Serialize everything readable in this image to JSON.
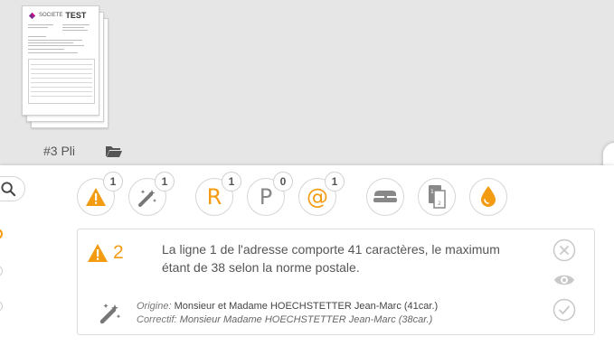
{
  "document": {
    "label": "#3 Pli",
    "logo_company": "SOCIETE",
    "logo_test": "TEST"
  },
  "toolbar": {
    "tools": [
      {
        "name": "warning",
        "badge": "1"
      },
      {
        "name": "magic-wand",
        "badge": "1"
      },
      {
        "name": "recommande",
        "letter": "R",
        "badge": "1"
      },
      {
        "name": "prioritaire",
        "letter": "P",
        "badge": "0"
      },
      {
        "name": "email",
        "letter": "@",
        "badge": "1"
      },
      {
        "name": "stapler"
      },
      {
        "name": "pages"
      },
      {
        "name": "ink-drop"
      }
    ]
  },
  "alert": {
    "count": "2",
    "message": "La ligne 1 de l'adresse comporte 41 caractères, le maximum étant de 38 selon la norme postale.",
    "origin_label": "Origine:",
    "origin_value": "Monsieur et Madame HOECHSTETTER Jean-Marc (41car.)",
    "correctif_label": "Correctif:",
    "correctif_value": "Monsieur Madame HOECHSTETTER Jean-Marc (38car.)"
  },
  "colors": {
    "accent": "#f39c12",
    "icon_grey": "#777777",
    "background_grey": "#e6e6e6"
  }
}
